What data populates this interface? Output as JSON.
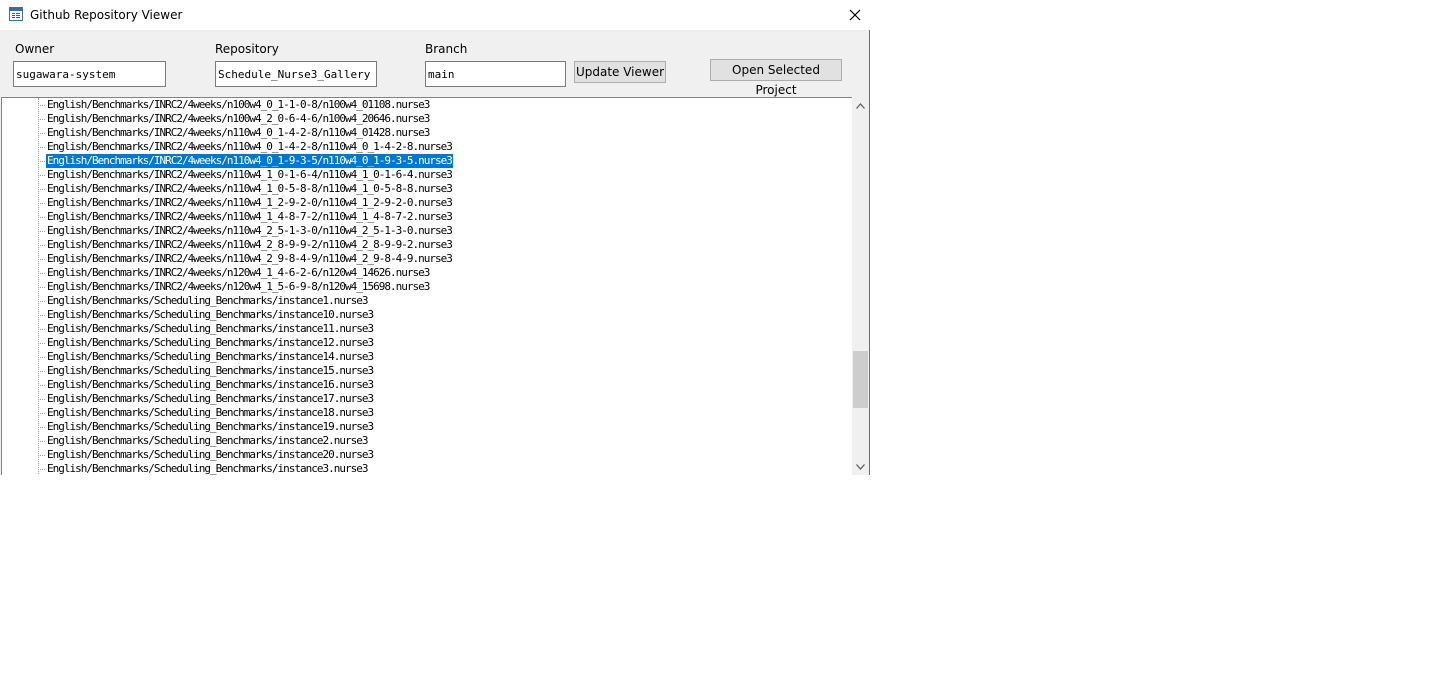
{
  "window": {
    "title": "Github Repository Viewer"
  },
  "form": {
    "owner_label": "Owner",
    "owner_value": "sugawara-system",
    "repository_label": "Repository",
    "repository_value": "Schedule_Nurse3_Gallery",
    "branch_label": "Branch",
    "branch_value": "main",
    "update_button": "Update Viewer",
    "open_button": "Open Selected Project"
  },
  "tree": {
    "selected_index": 4,
    "items": [
      "English/Benchmarks/INRC2/4weeks/n100w4_0_1-1-0-8/n100w4_01108.nurse3",
      "English/Benchmarks/INRC2/4weeks/n100w4_2_0-6-4-6/n100w4_20646.nurse3",
      "English/Benchmarks/INRC2/4weeks/n110w4_0_1-4-2-8/n110w4_01428.nurse3",
      "English/Benchmarks/INRC2/4weeks/n110w4_0_1-4-2-8/n110w4_0_1-4-2-8.nurse3",
      "English/Benchmarks/INRC2/4weeks/n110w4_0_1-9-3-5/n110w4_0_1-9-3-5.nurse3",
      "English/Benchmarks/INRC2/4weeks/n110w4_1_0-1-6-4/n110w4_1_0-1-6-4.nurse3",
      "English/Benchmarks/INRC2/4weeks/n110w4_1_0-5-8-8/n110w4_1_0-5-8-8.nurse3",
      "English/Benchmarks/INRC2/4weeks/n110w4_1_2-9-2-0/n110w4_1_2-9-2-0.nurse3",
      "English/Benchmarks/INRC2/4weeks/n110w4_1_4-8-7-2/n110w4_1_4-8-7-2.nurse3",
      "English/Benchmarks/INRC2/4weeks/n110w4_2_5-1-3-0/n110w4_2_5-1-3-0.nurse3",
      "English/Benchmarks/INRC2/4weeks/n110w4_2_8-9-9-2/n110w4_2_8-9-9-2.nurse3",
      "English/Benchmarks/INRC2/4weeks/n110w4_2_9-8-4-9/n110w4_2_9-8-4-9.nurse3",
      "English/Benchmarks/INRC2/4weeks/n120w4_1_4-6-2-6/n120w4_14626.nurse3",
      "English/Benchmarks/INRC2/4weeks/n120w4_1_5-6-9-8/n120w4_15698.nurse3",
      "English/Benchmarks/Scheduling_Benchmarks/instance1.nurse3",
      "English/Benchmarks/Scheduling_Benchmarks/instance10.nurse3",
      "English/Benchmarks/Scheduling_Benchmarks/instance11.nurse3",
      "English/Benchmarks/Scheduling_Benchmarks/instance12.nurse3",
      "English/Benchmarks/Scheduling_Benchmarks/instance14.nurse3",
      "English/Benchmarks/Scheduling_Benchmarks/instance15.nurse3",
      "English/Benchmarks/Scheduling_Benchmarks/instance16.nurse3",
      "English/Benchmarks/Scheduling_Benchmarks/instance17.nurse3",
      "English/Benchmarks/Scheduling_Benchmarks/instance18.nurse3",
      "English/Benchmarks/Scheduling_Benchmarks/instance19.nurse3",
      "English/Benchmarks/Scheduling_Benchmarks/instance2.nurse3",
      "English/Benchmarks/Scheduling_Benchmarks/instance20.nurse3",
      "English/Benchmarks/Scheduling_Benchmarks/instance3.nurse3"
    ]
  },
  "colors": {
    "selection": "#0078d7",
    "window_bg": "#f0f0f0"
  },
  "icons": {
    "app": "window-app-icon",
    "close": "close-icon",
    "scroll_up": "chevron-up-icon",
    "scroll_down": "chevron-down-icon"
  }
}
